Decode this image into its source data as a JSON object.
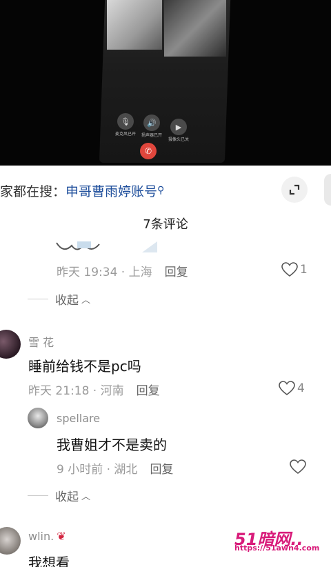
{
  "video": {
    "controls": [
      {
        "icon": "microphone-icon",
        "label": "麦克风已开"
      },
      {
        "icon": "speaker-icon",
        "label": "扬声器已开"
      },
      {
        "icon": "camera-off-icon",
        "label": "摄像头已关"
      }
    ],
    "hangup_icon": "hangup-icon"
  },
  "search": {
    "prefix": "家都在搜：",
    "query": "申哥曹雨婷账号"
  },
  "comments_header": {
    "count_label": "7条评论"
  },
  "comments": [
    {
      "time_location": "昨天 19:34 · 上海",
      "reply_label": "回复",
      "likes": "1",
      "collapse_label": "收起"
    },
    {
      "username": "雪 花",
      "text": "睡前给钱不是pc吗",
      "time_location": "昨天 21:18 · 河南",
      "reply_label": "回复",
      "likes": "4",
      "replies": [
        {
          "username": "spellare",
          "text": "我曹姐才不是卖的",
          "time_location": "9 小时前 · 湖北",
          "reply_label": "回复",
          "likes": ""
        }
      ],
      "collapse_label": "收起"
    },
    {
      "username": "wlin.",
      "text": "我想看"
    }
  ],
  "watermark": {
    "logo": "51暗网..",
    "url": "https://51awn4.com"
  },
  "colors": {
    "link": "#1f4f9c",
    "watermark": "#d81b7a",
    "hangup": "#e0463c"
  }
}
